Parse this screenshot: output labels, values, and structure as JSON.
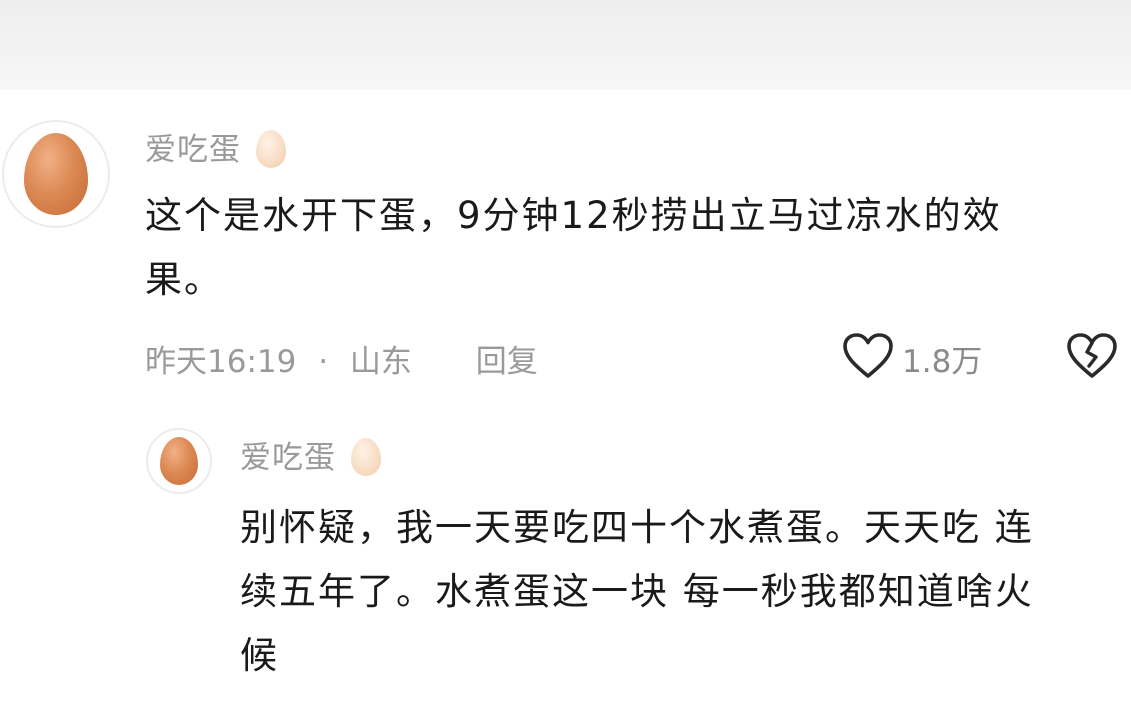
{
  "comment": {
    "username": "爱吃蛋",
    "text_line1": "这个是水开下蛋，9分钟12秒捞出立马过凉水的效",
    "text_line2": "果。",
    "time": "昨天16:19",
    "separator": "·",
    "location": "山东",
    "reply_label": "回复",
    "like_count": "1.8万"
  },
  "reply": {
    "username": "爱吃蛋",
    "text_line1": "别怀疑，我一天要吃四十个水煮蛋。天天吃 连",
    "text_line2": "续五年了。水煮蛋这一块 每一秒我都知道啥火",
    "text_line3": "候"
  },
  "icons": {
    "like": "heart-outline-icon",
    "dislike": "broken-heart-icon",
    "avatar": "egg-avatar",
    "name_badge": "egg-badge-icon"
  },
  "colors": {
    "text": "#1a1a1a",
    "secondary": "#9a9a9a",
    "egg": "#dc8a55"
  }
}
